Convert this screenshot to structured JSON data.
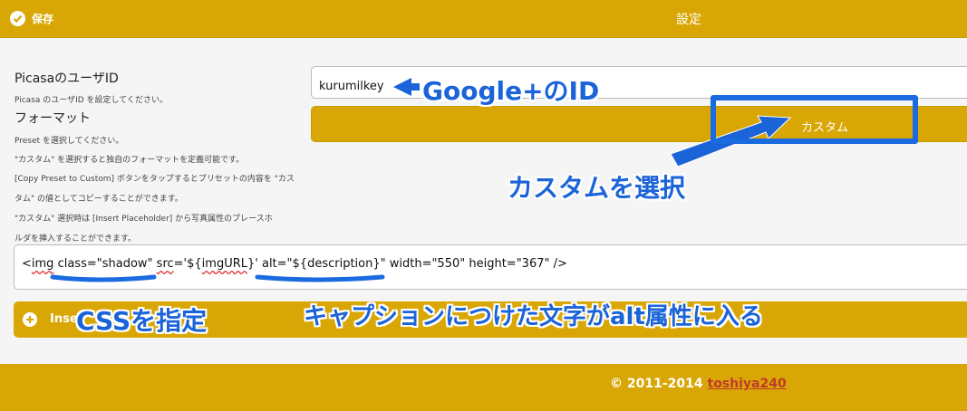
{
  "header": {
    "save_label": "保存",
    "title": "設定"
  },
  "form": {
    "picasa_id_label": "PicasaのユーザID",
    "picasa_id_help": "Picasa のユーザID を設定してください。",
    "picasa_id_value": "kurumilkey",
    "format_label": "フォーマット",
    "format_help": [
      "Preset を選択してください。",
      "\"カスタム\" を選択すると独自のフォーマットを定義可能です。",
      "[Copy Preset to Custom] ボタンをタップするとプリセットの内容を \"カス",
      "タム\" の値としてコピーすることができます。",
      "\"カスタム\" 選択時は [Insert Placeholder] から写真属性のプレースホ",
      "ルダを挿入することができます。"
    ],
    "format_value": "カスタム",
    "custom_code": {
      "p1": "<",
      "img": "img",
      "p2": " ",
      "class": "class",
      "p3": "=\"shadow\" ",
      "src": "src",
      "p4": "='${",
      "imgURL": "imgURL",
      "p5": "}' alt=\"${description}\" width=\"550\" height=\"367\" />"
    },
    "insert_label": "Inse"
  },
  "footer": {
    "copyright": "© 2011-2014",
    "author": "toshiya240"
  },
  "annotations": {
    "google_id": "Google+のID",
    "select_custom": "カスタムを選択",
    "css": "CSSを指定",
    "caption_alt": "キャプションにつけた文字がalt属性に入る"
  },
  "colors": {
    "accent": "#d9a705",
    "annotation": "#1a63d8"
  }
}
